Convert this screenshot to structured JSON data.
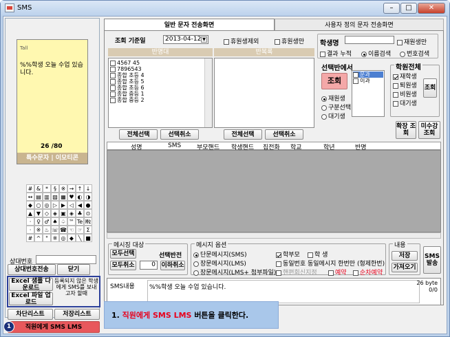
{
  "window": {
    "title": "SMS"
  },
  "tabs": [
    {
      "label": "일반 문자 전송화면"
    },
    {
      "label": "사용자 정의 문자 전송화면"
    }
  ],
  "phone": {
    "signal": "Tall",
    "message": "%%학생 오늘 수업 있습니다.",
    "counter": "26 /80",
    "special_label": "특수문자 | 이모티콘",
    "keys": [
      "#",
      "&",
      "*",
      "§",
      "※",
      "→",
      "↑",
      "↓",
      "↔",
      "▤",
      "▥",
      "▨",
      "▦",
      "♥",
      "◐",
      "◑",
      "◆",
      "○",
      "◎",
      "▷",
      "▶",
      "◁",
      "◀",
      "●",
      "▲",
      "▼",
      "◇",
      "◈",
      "▣",
      "◈",
      "♣",
      "⊙",
      "ㆍ",
      "♀",
      "♂",
      "♠",
      "♤",
      "™",
      "Te",
      "㎒",
      "ㆍ",
      "※",
      "♨",
      "☏",
      "☎",
      "☜",
      "☞",
      "Σ",
      "#",
      "^",
      "°",
      "※",
      "◎",
      "◆",
      "╲",
      "■"
    ],
    "counterpart_label": "상대번호"
  },
  "left_buttons": {
    "counterpart_send": "상대번호전송",
    "close": "닫기",
    "excel_download": "Excel 샘플 다운로드",
    "excel_upload": "Excel 파일 업로드",
    "note": "등록되지 않은 학생에게 SMS를 보내고자 할때",
    "block_list": "차단리스트",
    "save_list": "저장리스트",
    "staff_sms_lms": "직원에게 SMS LMS",
    "step_number": "1"
  },
  "query": {
    "base_date_label": "조회 기준일",
    "base_date": "2013-04-12",
    "excl_leave": "휴원생제외",
    "leave_only": "휴원생만"
  },
  "class_panel": {
    "header": "반명대",
    "items": [
      "4567 45",
      "7896543",
      "종합 초등 4",
      "종합 초등 5",
      "종합 초등 6",
      "종합 중등 1",
      "종합 중등 2"
    ],
    "select_all": "전체선택",
    "deselect": "선택취소"
  },
  "repeat_panel": {
    "header": "반복록",
    "select_all": "전체선택",
    "deselect": "선택취소"
  },
  "student_search": {
    "name_label": "학생명",
    "enrolled_only": "재원생만",
    "result_accum": "결과 누적",
    "name_search": "이름검색",
    "phone_search": "번호검색"
  },
  "selection": {
    "title": "선택반에서",
    "query_button": "조회",
    "enrolled": "재원생",
    "by_status": "구분선택",
    "waiting": "대기생",
    "subjects": [
      "문과",
      "이과"
    ]
  },
  "academy_all": {
    "title": "학원전체",
    "enrolled": "재학생",
    "withdrawn": "퇴원생",
    "non_student": "비원생",
    "waiting": "대기생",
    "query_button": "조회"
  },
  "extra_buttons": {
    "expand_query": "확장 조회",
    "unpaid_query": "미수강 조회"
  },
  "table": {
    "columns": [
      "성명",
      "SMS",
      "부모핸드",
      "학생핸드",
      "집전화",
      "학교",
      "학년",
      "반명"
    ]
  },
  "recipients": {
    "title": "메시징 대상",
    "select_all": "모두선택",
    "cancel_all": "모두취소",
    "select_invert": "선택반전",
    "count": "0",
    "cancel_below": "이하취소"
  },
  "message_options": {
    "title": "메시지 옵션",
    "sms": "단문메시지(SMS)",
    "lms": "장문메시지(LMS)",
    "lms_attach": "장문메시지(LMS+ 첨부파일)",
    "parent": "학부모",
    "student": "학 생",
    "same_number": "동일번호 동일메시지 한번만 (형제한번)",
    "recv_reject": "핸편회신지정",
    "reserve": "예약",
    "seq_reserve": "순차예약"
  },
  "content": {
    "title": "내용",
    "save": "저장",
    "load": "가져오기",
    "send": "SMS 발송"
  },
  "sms_content": {
    "label": "SMS내용",
    "text": "%%학생 오늘 수업 있습니다.",
    "bytes": "26 byte",
    "page": "0/0"
  },
  "instruction": {
    "prefix": "1. ",
    "highlight": "직원에게 SMS LMS",
    "suffix": " 버튼을 클릭한다."
  },
  "colors": {
    "titlebar": "#c4d6ee",
    "red_button": "#e8585c",
    "highlight_text": "#e8001c",
    "instruction_bg": "#a9c7ea"
  }
}
